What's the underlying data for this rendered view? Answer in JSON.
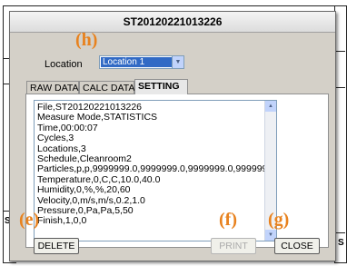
{
  "dialog": {
    "title": "ST20120221013226"
  },
  "annotations": {
    "h": "(h)",
    "e": "(e)",
    "f": "(f)",
    "g": "(g)"
  },
  "location": {
    "label": "Location",
    "selected": "Location 1"
  },
  "tabs": [
    {
      "label": "RAW DATA",
      "active": false
    },
    {
      "label": "CALC DATA",
      "active": false
    },
    {
      "label": "SETTING",
      "active": true
    }
  ],
  "setting_lines": [
    "File,ST20120221013226",
    "Measure Mode,STATISTICS",
    "Time,00:00:07",
    "Cycles,3",
    "Locations,3",
    "Schedule,Cleanroom2",
    "Particles,p,p,9999999.0,9999999.0,9999999.0,9999999",
    "Temperature,0,C,C,10.0,40.0",
    "Humidity,0,%,%,20,60",
    "Velocity,0,m/s,m/s,0.2,1.0",
    "Pressure,0,Pa,Pa,5,50",
    "Finish,1,0,0"
  ],
  "buttons": {
    "delete": "DELETE",
    "print": "PRINT",
    "close": "CLOSE"
  },
  "background": {
    "s1": "S",
    "s2": "S"
  },
  "colors": {
    "annotation": "#e8821e",
    "selection": "#316ac5",
    "dialog_bg": "#d4d0c8"
  }
}
